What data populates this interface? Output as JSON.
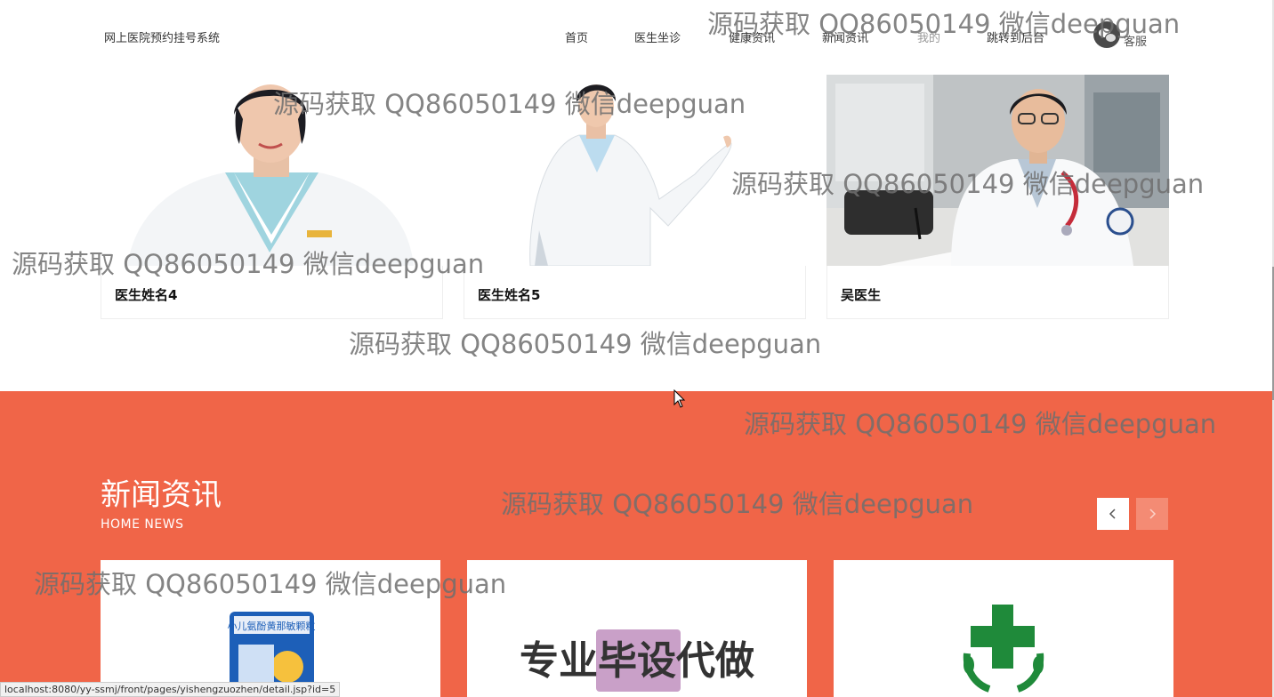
{
  "header": {
    "brand": "网上医院预约挂号系统",
    "nav": [
      "首页",
      "医生坐诊",
      "健康资讯",
      "新闻资讯",
      "我的",
      "跳转到后台"
    ],
    "customer_service": "客服"
  },
  "doctors": [
    {
      "name": "医生姓名4"
    },
    {
      "name": "医生姓名5"
    },
    {
      "name": "吴医生"
    }
  ],
  "news": {
    "title": "新闻资讯",
    "subtitle": "HOME NEWS",
    "card2_overlay_text": "专业毕设代做",
    "product_label": "小儿氨酚黄那敏颗粒"
  },
  "status_bar": "localhost:8080/yy-ssmj/front/pages/yishengzuozhen/detail.jsp?id=5",
  "watermark": "源码获取 QQ86050149 微信deepguan",
  "colors": {
    "accent": "#f06548",
    "arrow_next": "#f48b74"
  }
}
